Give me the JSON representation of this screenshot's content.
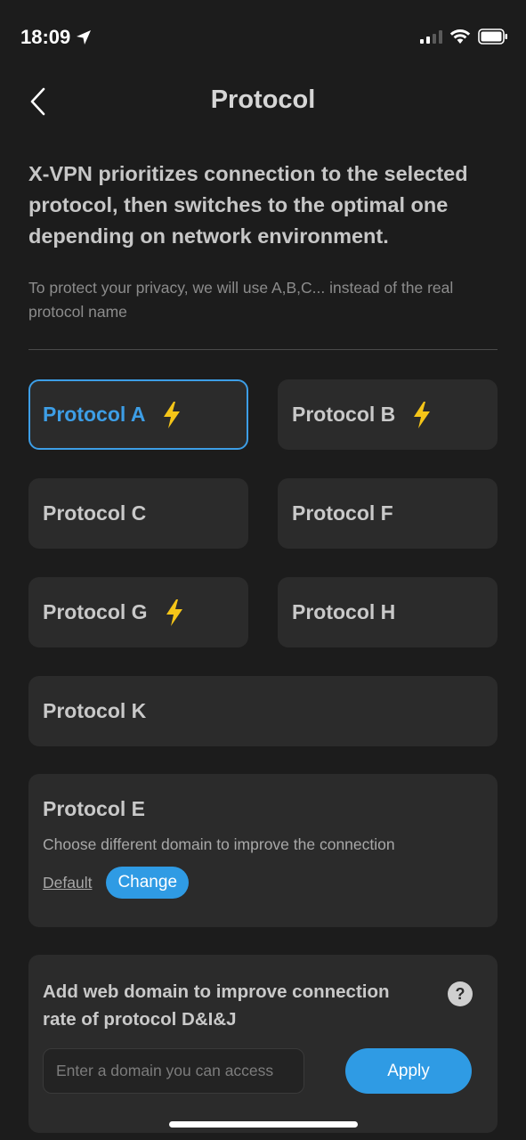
{
  "status_bar": {
    "time": "18:09"
  },
  "header": {
    "title": "Protocol"
  },
  "intro": "X-VPN prioritizes connection to the selected protocol, then switches to the optimal one depending on network environment.",
  "note": "To protect your privacy, we will use A,B,C... instead of the real protocol name",
  "protocols": [
    {
      "label": "Protocol A",
      "fast": true,
      "selected": true
    },
    {
      "label": "Protocol B",
      "fast": true,
      "selected": false
    },
    {
      "label": "Protocol C",
      "fast": false,
      "selected": false
    },
    {
      "label": "Protocol F",
      "fast": false,
      "selected": false
    },
    {
      "label": "Protocol G",
      "fast": true,
      "selected": false
    },
    {
      "label": "Protocol H",
      "fast": false,
      "selected": false
    },
    {
      "label": "Protocol K",
      "fast": false,
      "selected": false
    }
  ],
  "protocol_e": {
    "title": "Protocol E",
    "description": "Choose different domain to improve the connection",
    "default_label": "Default",
    "change_label": "Change"
  },
  "web_domain": {
    "title": "Add web domain to improve connection rate of protocol D&I&J",
    "help_symbol": "?",
    "input_placeholder": "Enter a domain you can access",
    "input_value": "",
    "apply_label": "Apply"
  },
  "colors": {
    "accent": "#2f9be4",
    "bolt": "#f5c518",
    "background": "#1c1c1c",
    "card": "#2b2b2b"
  }
}
